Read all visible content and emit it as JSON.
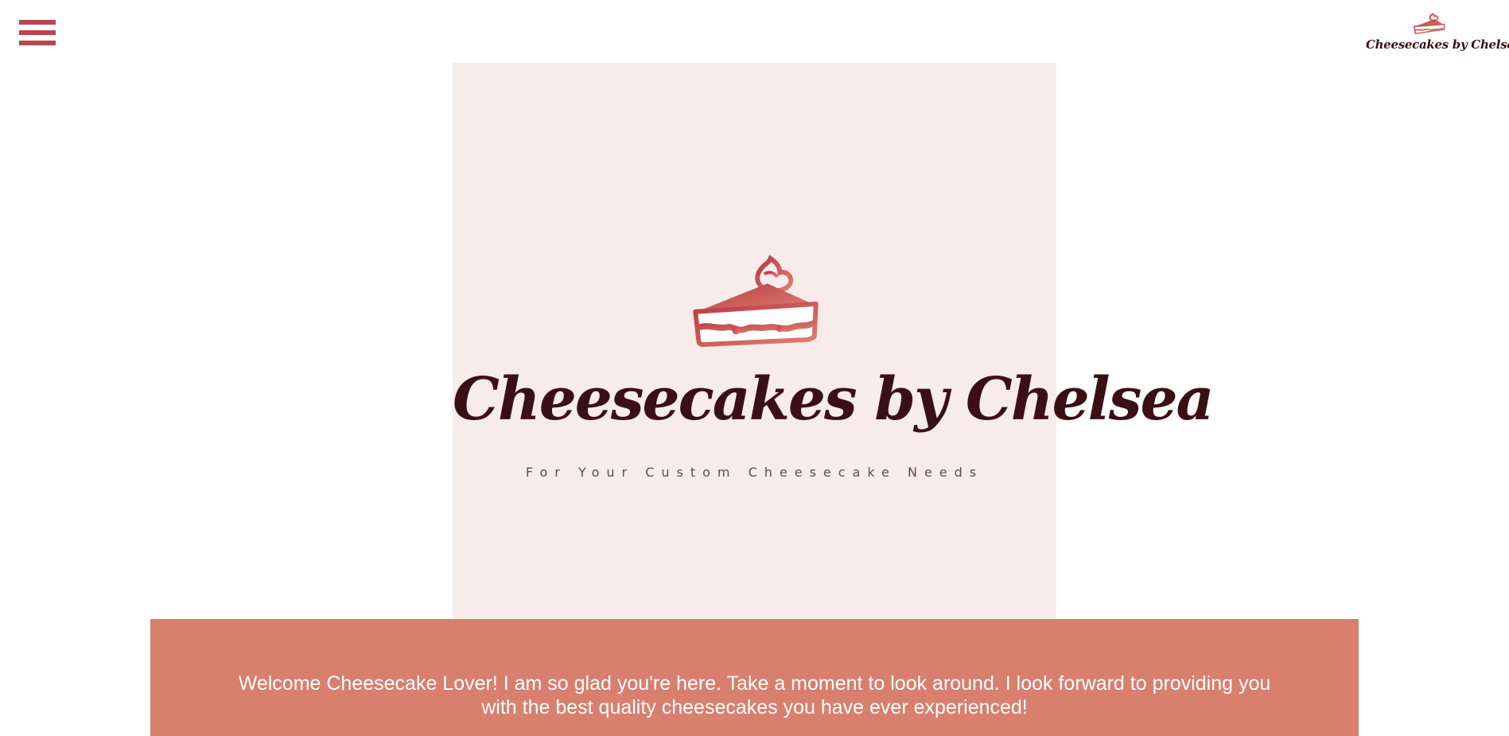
{
  "nav": {
    "menu_icon": "hamburger-menu-icon"
  },
  "header": {
    "logo_icon": "cheesecake-slice-icon",
    "logo_text": "Cheesecakes by Chelsea"
  },
  "hero": {
    "icon": "cheesecake-slice-icon",
    "title": "Cheesecakes by Chelsea",
    "tagline": "For Your Custom Cheesecake Needs"
  },
  "welcome": {
    "line1": "Welcome Cheesecake Lover! I am so glad you're here. Take a moment to look around. I look forward to providing you",
    "line2": "with the best quality cheesecakes you have ever experienced!"
  },
  "colors": {
    "accent": "#b7474d",
    "hero_bg": "#f7ece9",
    "welcome_bg": "#d87f6e",
    "title": "#3a1016",
    "tagline": "#5e4a4a",
    "welcome_text": "#ffffff"
  }
}
